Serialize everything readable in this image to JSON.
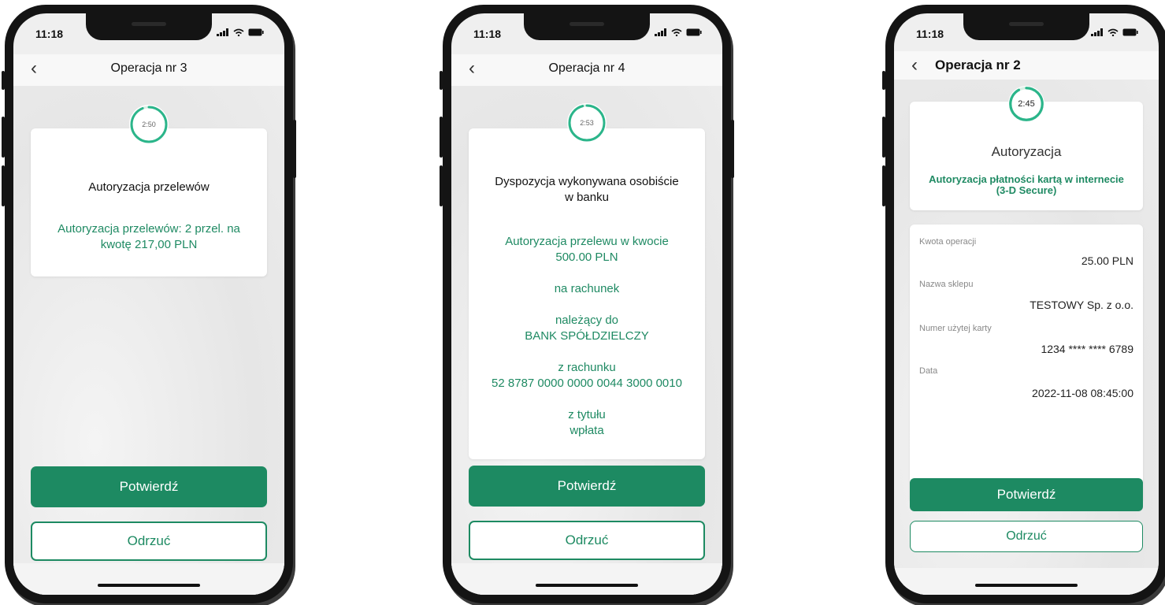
{
  "colors": {
    "brand_green": "#1d8a62",
    "frame": "#141414",
    "background": "#efefef"
  },
  "phones": [
    {
      "status_time": "11:18",
      "title": "Operacja nr 3",
      "timer": "2:50",
      "timer_progress": 0.94,
      "card_title": "Autoryzacja przelewów",
      "message_line1": "Autoryzacja przelewów: 2 przel. na",
      "message_line2": "kwotę 217,00 PLN",
      "confirm_label": "Potwierdź",
      "reject_label": "Odrzuć"
    },
    {
      "status_time": "11:18",
      "title": "Operacja nr 4",
      "timer": "2:53",
      "timer_progress": 0.96,
      "card_title_line1": "Dyspozycja wykonywana osobiście",
      "card_title_line2": "w banku",
      "amount_line1": "Autoryzacja przelewu w kwocie",
      "amount_line2": "500.00 PLN",
      "to_account": "na rachunek",
      "owner_line1": "należący do",
      "owner_line2": "BANK SPÓŁDZIELCZY",
      "from_line1": "z rachunku",
      "from_line2": "52 8787 0000 0000 0044 3000 0010",
      "title_line1": "z tytułu",
      "title_line2": "wpłata",
      "confirm_label": "Potwierdź",
      "reject_label": "Odrzuć"
    },
    {
      "status_time": "11:18",
      "title": "Operacja nr 2",
      "timer": "2:45",
      "timer_progress": 0.92,
      "card_title": "Autoryzacja",
      "subtitle_line1": "Autoryzacja płatności kartą w internecie",
      "subtitle_line2": "(3-D Secure)",
      "details": [
        {
          "label": "Kwota operacji",
          "value": "25.00 PLN"
        },
        {
          "label": "Nazwa sklepu",
          "value": "TESTOWY Sp. z o.o."
        },
        {
          "label": "Numer użytej karty",
          "value": "1234 **** **** 6789"
        },
        {
          "label": "Data",
          "value": "2022-11-08 08:45:00"
        }
      ],
      "confirm_label": "Potwierdź",
      "reject_label": "Odrzuć"
    }
  ]
}
